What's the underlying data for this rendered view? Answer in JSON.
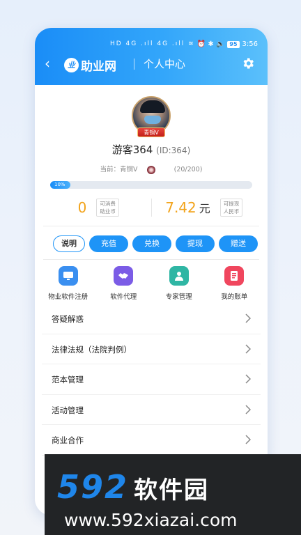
{
  "status_bar": {
    "signal": "HD 4G .ıll 4G .ıll ≋",
    "icons": "⏰ ✱ 🔈",
    "battery": "95",
    "time": "3:56"
  },
  "header": {
    "back_icon": "back-arrow-icon",
    "logo_mark": "业",
    "logo_text": "助业网",
    "title": "个人中心",
    "settings_icon": "gear-icon"
  },
  "profile": {
    "level_badge": "青铜V",
    "name": "游客364",
    "id_text": "(ID:364)",
    "level_prefix": "当前：",
    "level_name": "青铜V",
    "level_count": "(20/200)",
    "progress_label": "10%",
    "progress_fraction": 0.1
  },
  "balance": {
    "coins_value": "0",
    "coins_tag_line1": "可消费",
    "coins_tag_line2": "助业币",
    "money_value": "7.42",
    "money_unit": "元",
    "money_tag_line1": "可提现",
    "money_tag_line2": "人民币"
  },
  "actions": [
    {
      "label": "说明"
    },
    {
      "label": "充值"
    },
    {
      "label": "兑换"
    },
    {
      "label": "提现"
    },
    {
      "label": "赠送"
    }
  ],
  "shortcuts": [
    {
      "label": "物业软件注册",
      "icon": "monitor-icon",
      "color": "#3a8ff0"
    },
    {
      "label": "软件代理",
      "icon": "handshake-icon",
      "color": "#7b5ce6"
    },
    {
      "label": "专家管理",
      "icon": "person-icon",
      "color": "#2fb6a4"
    },
    {
      "label": "我的账单",
      "icon": "bill-icon",
      "color": "#f0465e"
    }
  ],
  "menu": [
    {
      "label": "答疑解惑"
    },
    {
      "label": "法律法规（法院判例）"
    },
    {
      "label": "范本管理"
    },
    {
      "label": "活动管理"
    },
    {
      "label": "商业合作"
    }
  ],
  "watermark": {
    "number": "592",
    "name": "软件园",
    "url": "www.592xiazai.com"
  },
  "colors": {
    "accent": "#1e94f7",
    "balance": "#f2a31a"
  }
}
